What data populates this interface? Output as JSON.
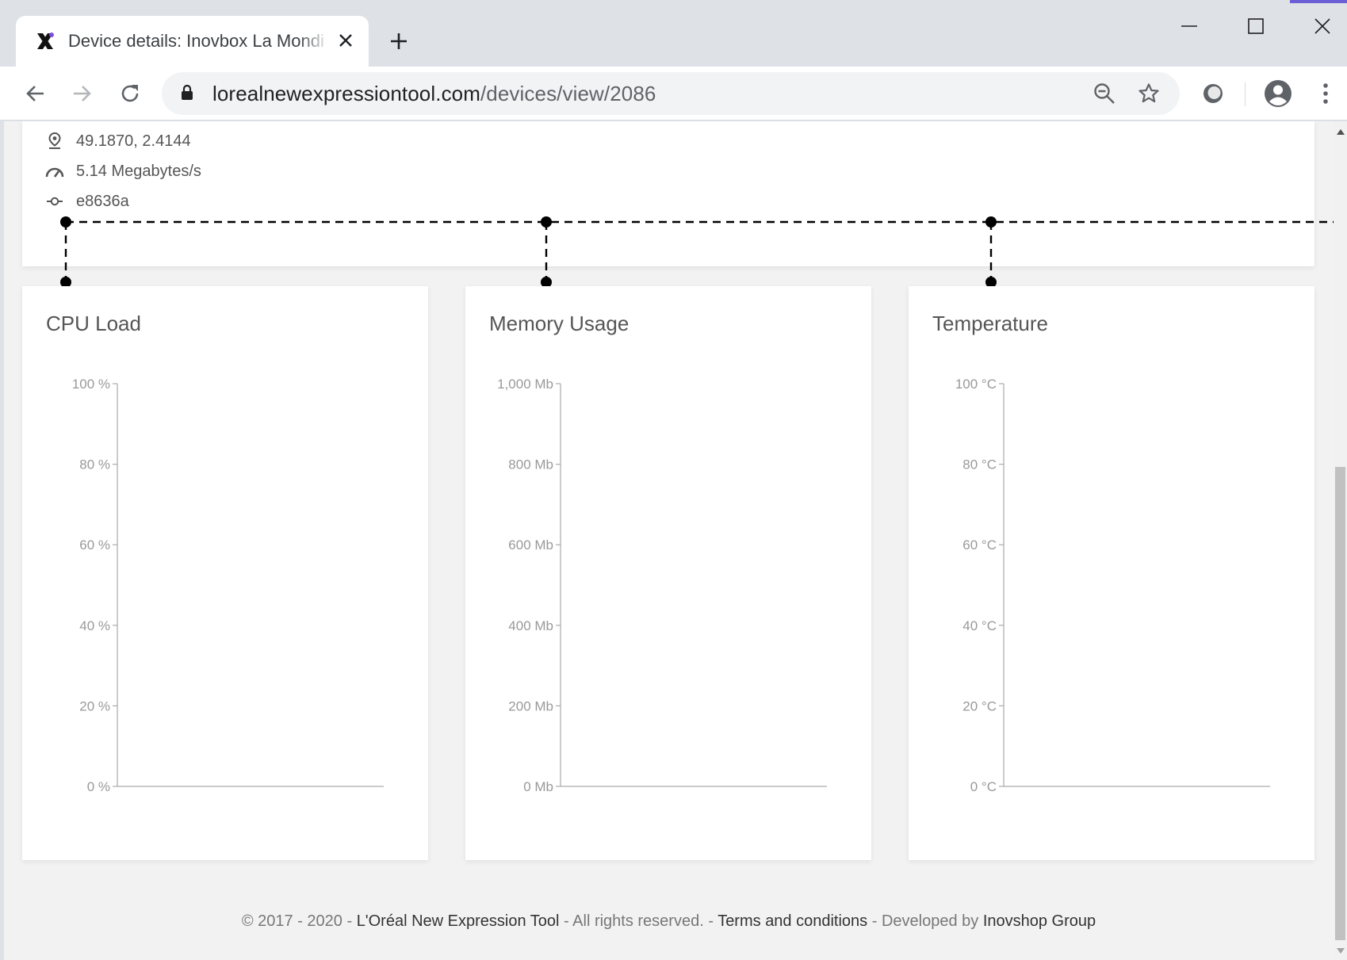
{
  "browser": {
    "tab_title": "Device details: Inovbox La Mondi",
    "url_domain": "lorealnewexpressiontool.com",
    "url_path": "/devices/view/2086"
  },
  "device_info": {
    "location": "49.1870, 2.4144",
    "speed": "5.14 Megabytes/s",
    "commit": "e8636a"
  },
  "charts": {
    "cpu": {
      "title": "CPU Load"
    },
    "memory": {
      "title": "Memory Usage"
    },
    "temperature": {
      "title": "Temperature"
    }
  },
  "chart_data": [
    {
      "type": "line",
      "title": "CPU Load",
      "ylim": [
        0,
        100
      ],
      "yticks": [
        "0 %",
        "20 %",
        "40 %",
        "60 %",
        "80 %",
        "100 %"
      ],
      "series": []
    },
    {
      "type": "line",
      "title": "Memory Usage",
      "ylim": [
        0,
        1000
      ],
      "yticks": [
        "0 Mb",
        "200 Mb",
        "400 Mb",
        "600 Mb",
        "800 Mb",
        "1,000 Mb"
      ],
      "series": []
    },
    {
      "type": "line",
      "title": "Temperature",
      "ylim": [
        0,
        100
      ],
      "yticks": [
        "0 °C",
        "20 °C",
        "40 °C",
        "60 °C",
        "80 °C",
        "100 °C"
      ],
      "series": []
    }
  ],
  "footer": {
    "copyright": "© 2017 - 2020 - ",
    "app_name": "L'Oréal New Expression Tool",
    "rights": " - All rights reserved. - ",
    "terms": "Terms and conditions",
    "developed": " - Developed by ",
    "developer": "Inovshop Group"
  }
}
